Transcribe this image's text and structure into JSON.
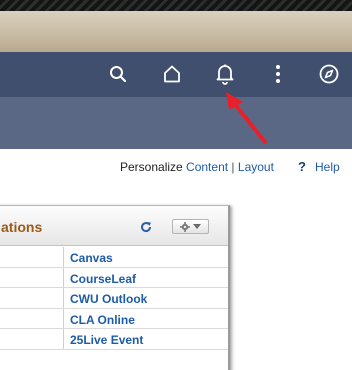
{
  "header": {
    "nav_icons": [
      "search-icon",
      "home-icon",
      "bell-icon",
      "more-vertical-icon",
      "compass-icon"
    ],
    "nav_color": "#3f4f6d"
  },
  "personalize": {
    "label": "Personalize",
    "content_link": "Content",
    "separator": "|",
    "layout_link": "Layout",
    "help_icon": "?",
    "help_label": "Help"
  },
  "pagelet": {
    "title": "ations",
    "title_color": "#9c5a1c",
    "refresh_icon": "refresh-icon",
    "settings_icon": "gear-icon",
    "links": [
      "Canvas",
      "CourseLeaf",
      "CWU Outlook",
      "CLA Online",
      "25Live Event"
    ],
    "link_color": "#1e5ba8"
  },
  "annotation": {
    "arrow_color": "#e8202a"
  }
}
